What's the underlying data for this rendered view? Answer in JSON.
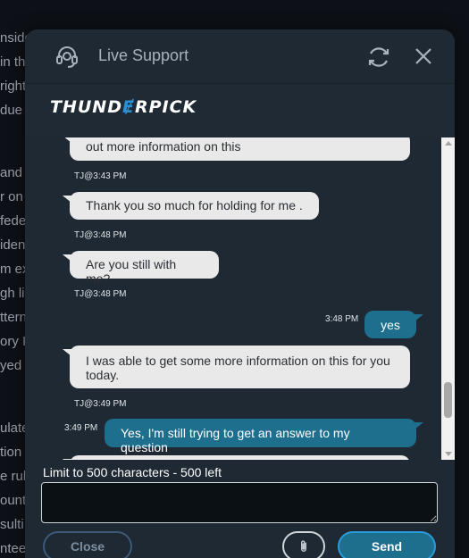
{
  "background_text": [
    "nside",
    "in th",
    "right",
    "due",
    "and",
    "r on",
    "fede",
    "iden",
    "m ex",
    "gh li",
    "ttern",
    "ory I",
    "yed",
    "ulate",
    "tion w",
    "e rule",
    "ount",
    "sulti",
    "ntee"
  ],
  "header": {
    "title": "Live Support",
    "headset_icon": "headset-icon",
    "refresh_icon": "refresh-icon",
    "close_icon": "close-icon"
  },
  "brand": {
    "logo_part1": "THUND",
    "logo_bolt": "Ɇ",
    "logo_part2": "RPICK"
  },
  "messages": [
    {
      "from": "agent",
      "text": "out more information on this"
    },
    {
      "from": "agent_stamp",
      "text": "TJ@3:43 PM"
    },
    {
      "from": "agent",
      "text": "Thank you so much for holding for me ."
    },
    {
      "from": "agent_stamp",
      "text": "TJ@3:48 PM"
    },
    {
      "from": "agent",
      "text": "Are you still with me?"
    },
    {
      "from": "agent_stamp",
      "text": "TJ@3:48 PM"
    },
    {
      "from": "user_stamp",
      "text": "3:48 PM"
    },
    {
      "from": "user",
      "text": "yes"
    },
    {
      "from": "agent",
      "text": "I was able to get some more information on this for you today."
    },
    {
      "from": "agent_stamp",
      "text": "TJ@3:49 PM"
    },
    {
      "from": "user_stamp",
      "text": "3:49 PM"
    },
    {
      "from": "user",
      "text": "Yes, I'm still trying to get an answer to my question"
    }
  ],
  "footer": {
    "limit": "Limit to 500 characters - 500 left",
    "input_value": "",
    "close_label": "Close",
    "attach_icon": "paperclip-icon",
    "send_label": "Send"
  },
  "colors": {
    "panel": "#1f2933",
    "user_bubble": "#1e6f8e",
    "agent_bubble": "#e9e9ea",
    "send_border": "#2a9bd8"
  }
}
